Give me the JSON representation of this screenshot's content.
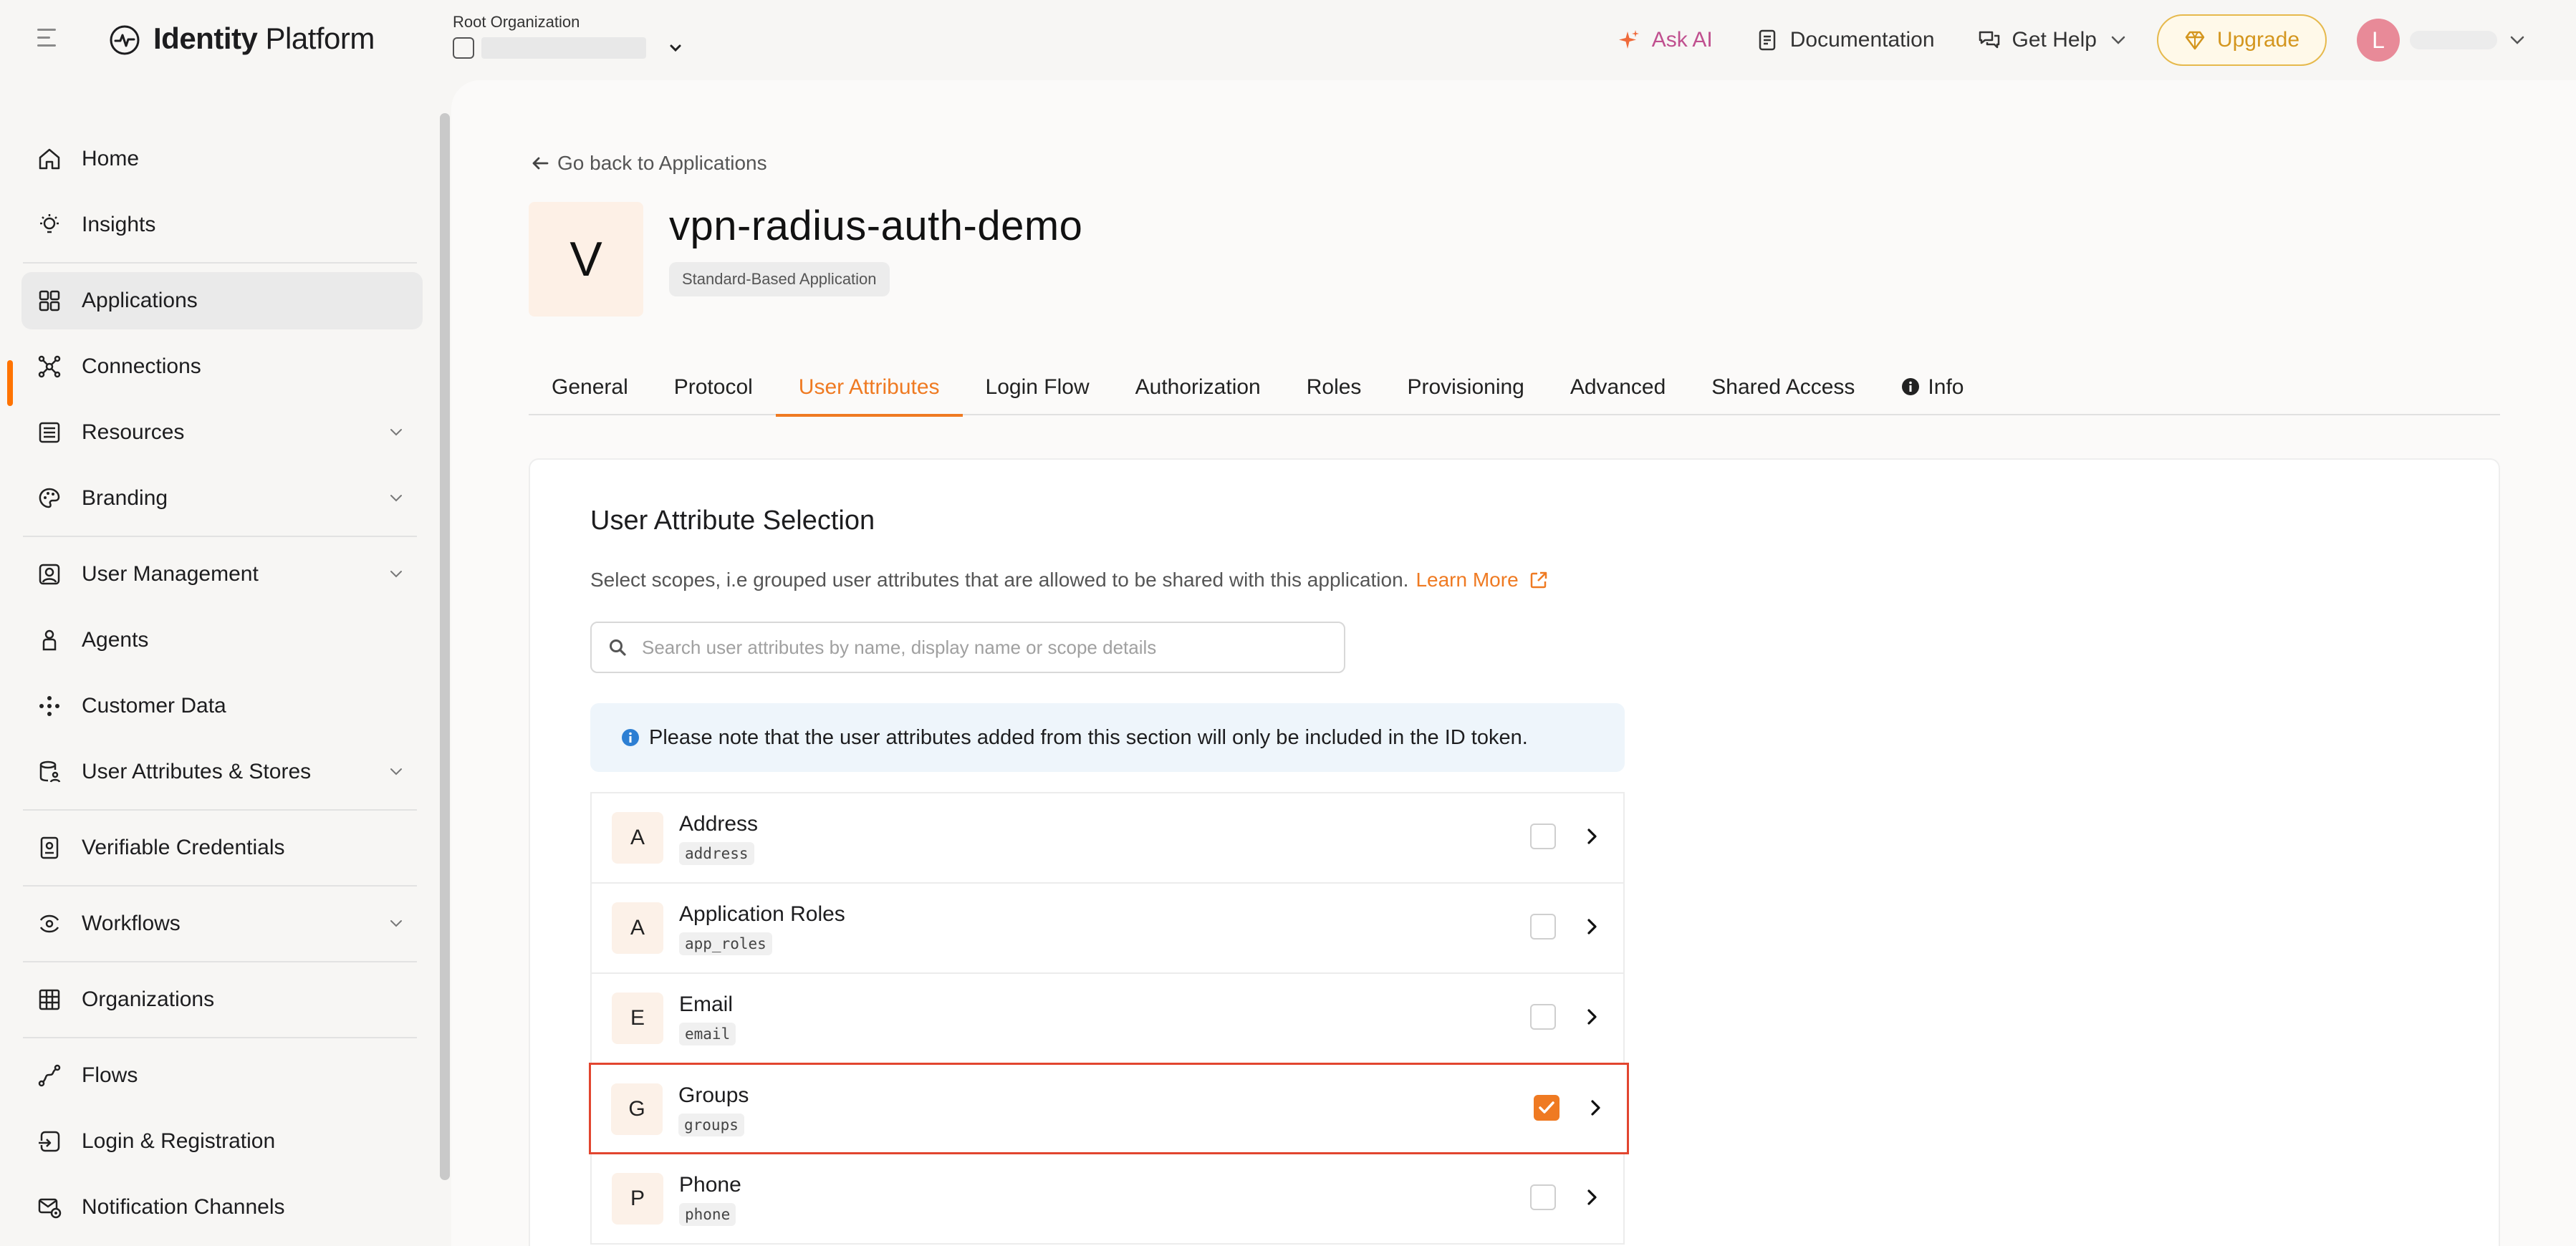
{
  "header": {
    "brand_bold": "Identity",
    "brand_rest": " Platform",
    "org_label": "Root Organization",
    "ask_ai": "Ask AI",
    "documentation": "Documentation",
    "get_help": "Get Help",
    "upgrade": "Upgrade",
    "avatar_initial": "L"
  },
  "sidebar": {
    "items": [
      {
        "label": "Home",
        "icon": "home-icon"
      },
      {
        "label": "Insights",
        "icon": "insights-icon"
      },
      {
        "label": "Applications",
        "icon": "applications-icon",
        "active": true
      },
      {
        "label": "Connections",
        "icon": "connections-icon"
      },
      {
        "label": "Resources",
        "icon": "resources-icon",
        "expandable": true
      },
      {
        "label": "Branding",
        "icon": "branding-icon",
        "expandable": true
      },
      {
        "label": "User Management",
        "icon": "user-management-icon",
        "expandable": true
      },
      {
        "label": "Agents",
        "icon": "agents-icon"
      },
      {
        "label": "Customer Data",
        "icon": "customer-data-icon"
      },
      {
        "label": "User Attributes & Stores",
        "icon": "user-attributes-icon",
        "expandable": true
      },
      {
        "label": "Verifiable Credentials",
        "icon": "verifiable-credentials-icon"
      },
      {
        "label": "Workflows",
        "icon": "workflows-icon",
        "expandable": true
      },
      {
        "label": "Organizations",
        "icon": "organizations-icon"
      },
      {
        "label": "Flows",
        "icon": "flows-icon"
      },
      {
        "label": "Login & Registration",
        "icon": "login-registration-icon"
      },
      {
        "label": "Notification Channels",
        "icon": "notification-channels-icon"
      }
    ]
  },
  "main": {
    "back_link": "Go back to Applications",
    "app_initial": "V",
    "app_title": "vpn-radius-auth-demo",
    "app_badge": "Standard-Based Application",
    "tabs": [
      {
        "label": "General"
      },
      {
        "label": "Protocol"
      },
      {
        "label": "User Attributes",
        "active": true
      },
      {
        "label": "Login Flow"
      },
      {
        "label": "Authorization"
      },
      {
        "label": "Roles"
      },
      {
        "label": "Provisioning"
      },
      {
        "label": "Advanced"
      },
      {
        "label": "Shared Access"
      },
      {
        "label": "Info",
        "icon": "info-icon"
      }
    ],
    "card": {
      "title": "User Attribute Selection",
      "description": "Select scopes, i.e grouped user attributes that are allowed to be shared with this application.",
      "learn_more": "Learn More",
      "search_placeholder": "Search user attributes by name, display name or scope details",
      "notice": "Please note that the user attributes added from this section will only be included in the ID token.",
      "attributes": [
        {
          "letter": "A",
          "name": "Address",
          "code": "address",
          "checked": false
        },
        {
          "letter": "A",
          "name": "Application Roles",
          "code": "app_roles",
          "checked": false
        },
        {
          "letter": "E",
          "name": "Email",
          "code": "email",
          "checked": false
        },
        {
          "letter": "G",
          "name": "Groups",
          "code": "groups",
          "checked": true
        },
        {
          "letter": "P",
          "name": "Phone",
          "code": "phone",
          "checked": false
        }
      ]
    }
  },
  "colors": {
    "accent": "#ef7a22",
    "highlight_border": "#e2452f",
    "ask_ai": "#c0508f",
    "upgrade": "#d4961e",
    "avatar": "#e88a98"
  }
}
